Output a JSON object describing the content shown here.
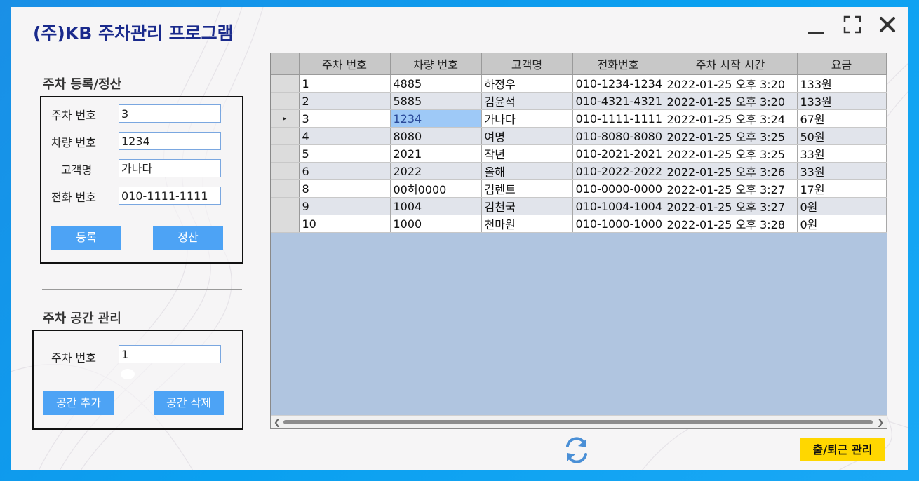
{
  "window": {
    "title": "(주)KB 주차관리 프로그램",
    "controls": {
      "minimize": "minimize-icon",
      "maximize": "maximize-icon",
      "close": "close-icon"
    }
  },
  "register": {
    "section_title": "주차 등록/정산",
    "fields": [
      {
        "label": "주차 번호",
        "value": "3"
      },
      {
        "label": "차량 번호",
        "value": "1234"
      },
      {
        "label": "고객명",
        "value": "가나다"
      },
      {
        "label": "전화 번호",
        "value": "010-1111-1111"
      }
    ],
    "register_button": "등록",
    "settle_button": "정산"
  },
  "space": {
    "section_title": "주차 공간 관리",
    "field": {
      "label": "주차 번호",
      "value": "1"
    },
    "add_button": "공간 추가",
    "delete_button": "공간 삭제"
  },
  "grid": {
    "columns": [
      "주차 번호",
      "차량 번호",
      "고객명",
      "전화번호",
      "주차 시작 시간",
      "요금"
    ],
    "rows": [
      [
        "1",
        "4885",
        "하정우",
        "010-1234-1234",
        "2022-01-25 오후 3:20",
        "133원"
      ],
      [
        "2",
        "5885",
        "김윤석",
        "010-4321-4321",
        "2022-01-25 오후 3:20",
        "133원"
      ],
      [
        "3",
        "1234",
        "가나다",
        "010-1111-1111",
        "2022-01-25 오후 3:24",
        "67원"
      ],
      [
        "4",
        "8080",
        "여명",
        "010-8080-8080",
        "2022-01-25 오후 3:25",
        "50원"
      ],
      [
        "5",
        "2021",
        "작년",
        "010-2021-2021",
        "2022-01-25 오후 3:25",
        "33원"
      ],
      [
        "6",
        "2022",
        "올해",
        "010-2022-2022",
        "2022-01-25 오후 3:26",
        "33원"
      ],
      [
        "8",
        "00허0000",
        "김렌트",
        "010-0000-0000",
        "2022-01-25 오후 3:27",
        "17원"
      ],
      [
        "9",
        "1004",
        "김천국",
        "010-1004-1004",
        "2022-01-25 오후 3:27",
        "0원"
      ],
      [
        "10",
        "1000",
        "천마원",
        "010-1000-1000",
        "2022-01-25 오후 3:28",
        "0원"
      ]
    ],
    "current_row_marker": "▸"
  },
  "footer": {
    "refresh_icon": "refresh-icon",
    "attendance_button": "출/퇴근 관리"
  },
  "colors": {
    "accent_button": "#4da3f5",
    "title": "#1a2a8c",
    "attendance_button": "#ffd700",
    "grid_background": "#b0c5e0",
    "selected_cell": "#9ec9f7"
  }
}
